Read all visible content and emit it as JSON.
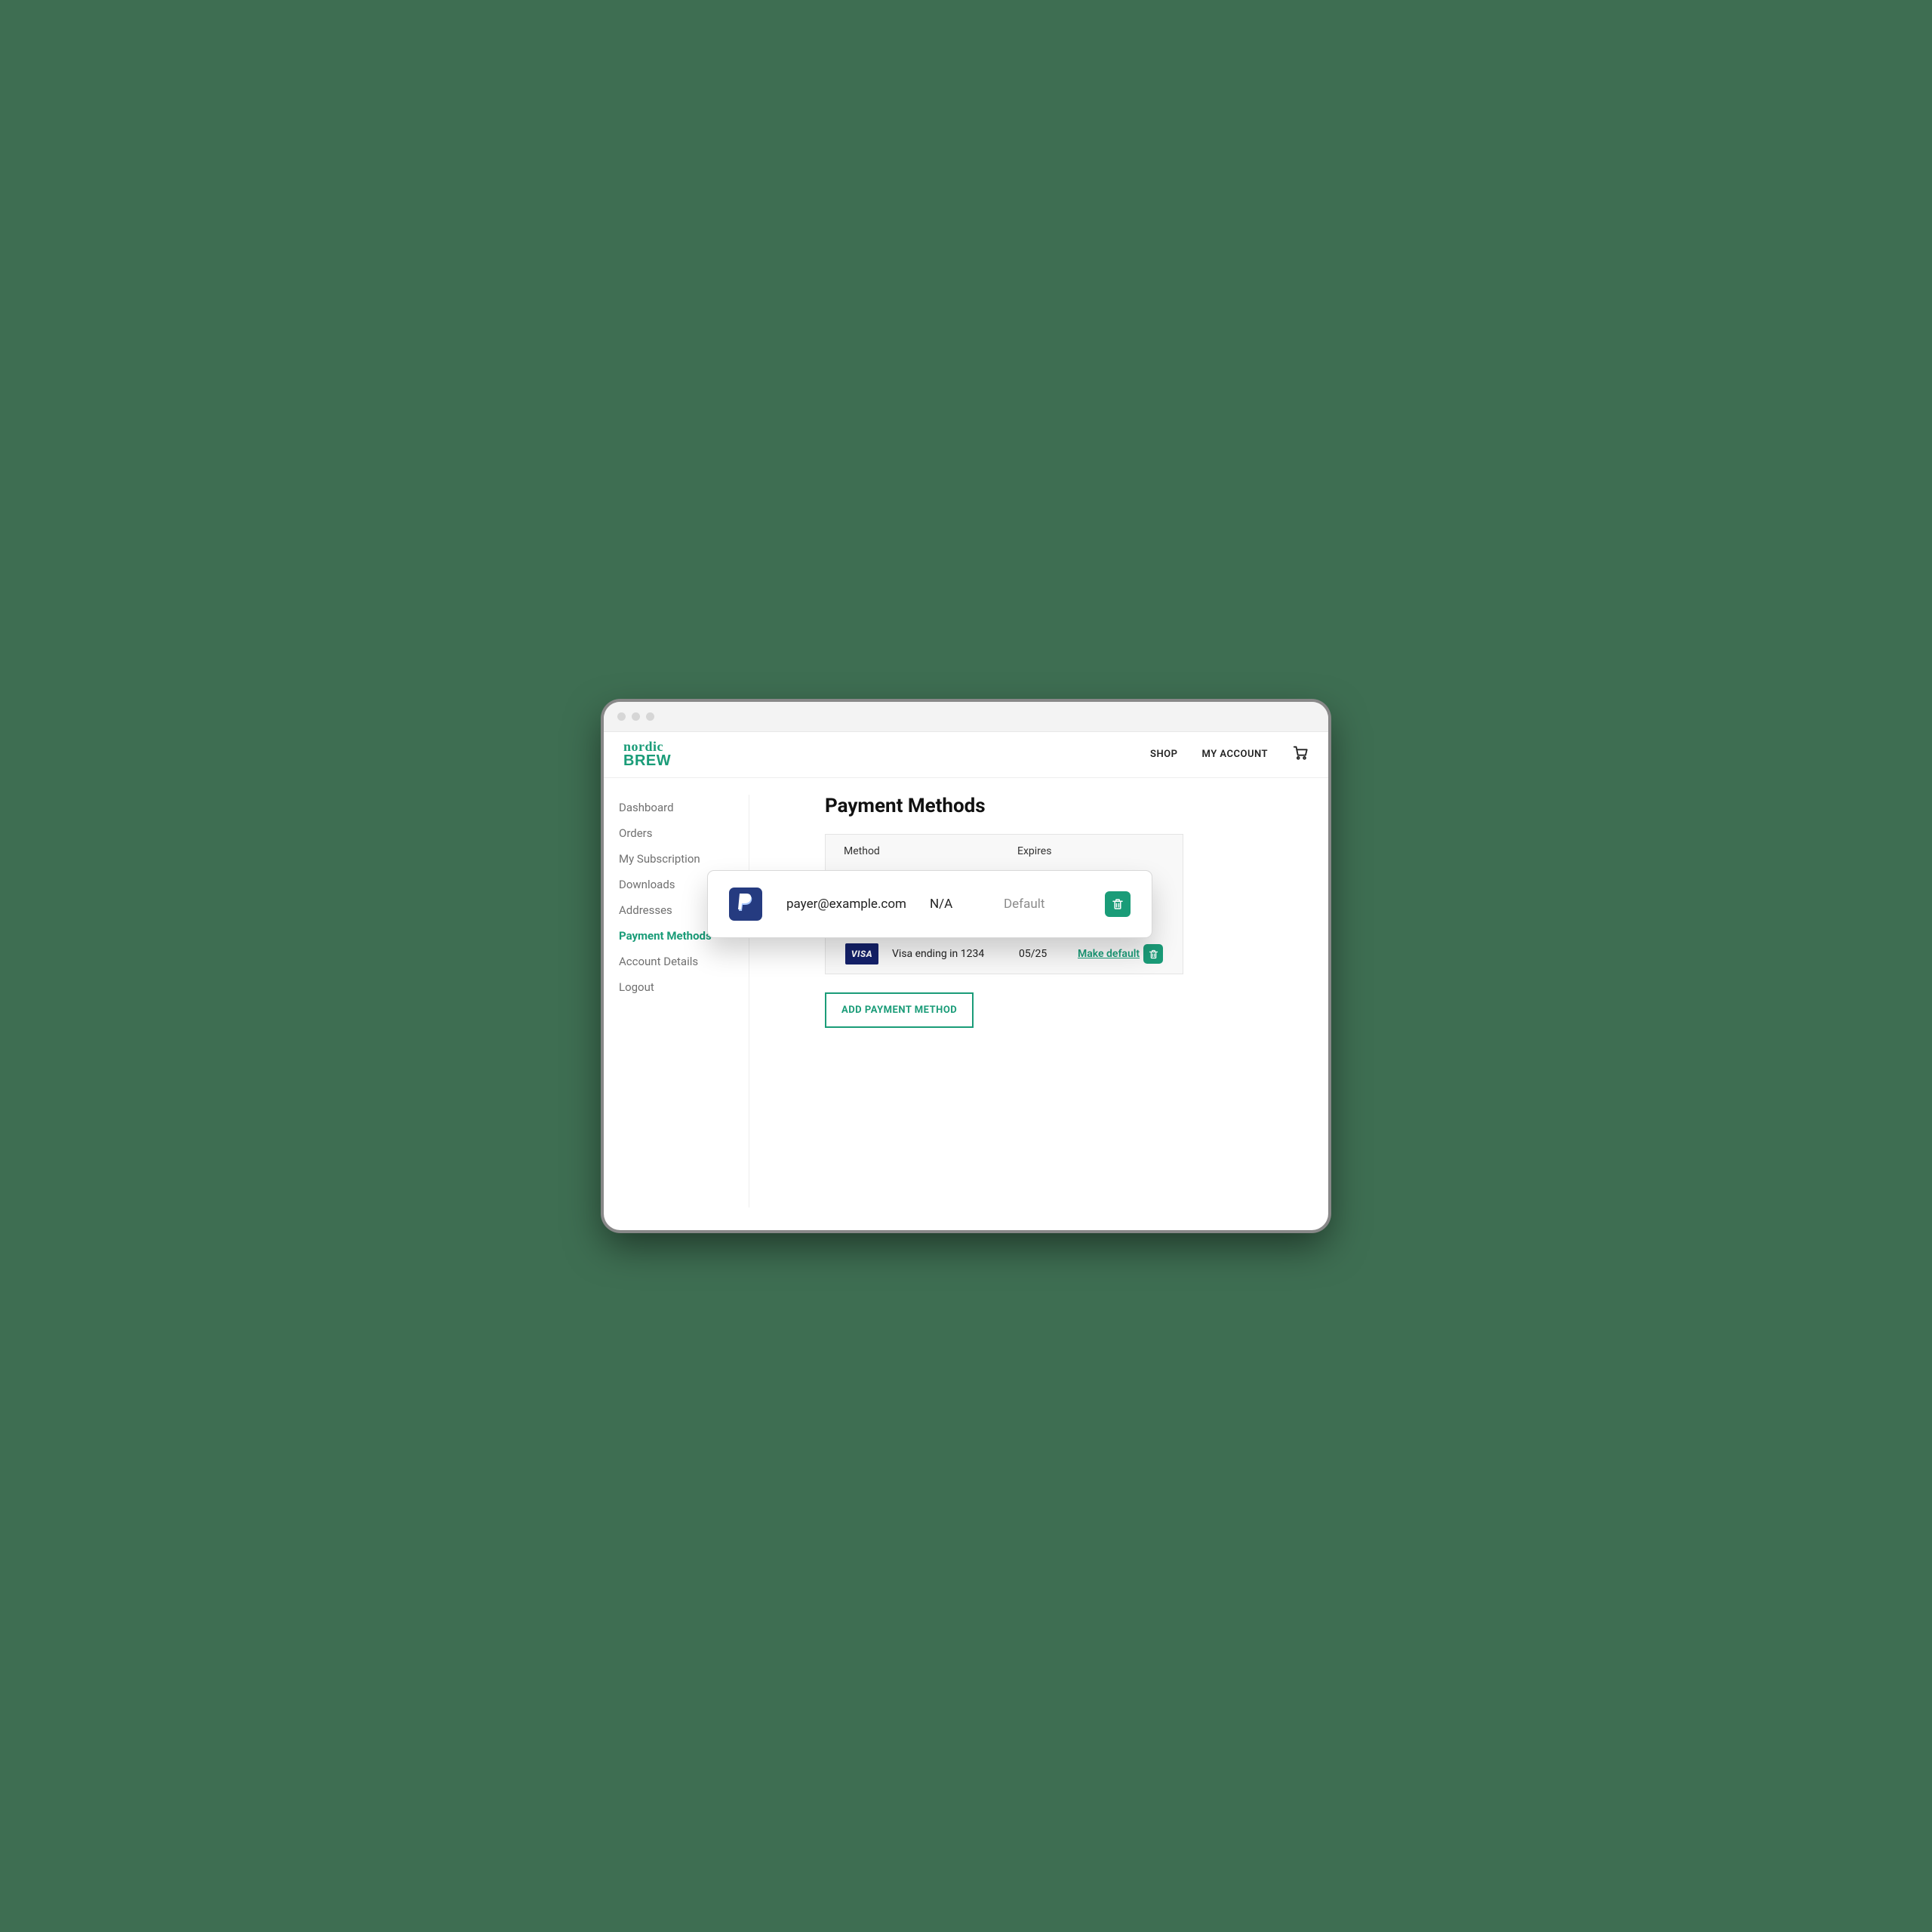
{
  "brand": {
    "top": "nordic",
    "bottom": "BREW"
  },
  "nav": {
    "shop": "SHOP",
    "account": "MY ACCOUNT"
  },
  "sidebar": {
    "items": [
      {
        "label": "Dashboard"
      },
      {
        "label": "Orders"
      },
      {
        "label": "My Subscription"
      },
      {
        "label": "Downloads"
      },
      {
        "label": "Addresses"
      },
      {
        "label": "Payment Methods"
      },
      {
        "label": "Account Details"
      },
      {
        "label": "Logout"
      }
    ],
    "active_index": 5
  },
  "page": {
    "title": "Payment Methods"
  },
  "table": {
    "headers": {
      "method": "Method",
      "expires": "Expires"
    },
    "paypal_row": {
      "brand": "PayPal",
      "email": "payer@example.com",
      "expires": "N/A",
      "status": "Default"
    },
    "visa_row": {
      "brand": "VISA",
      "desc": "Visa ending in 1234",
      "expires": "05/25",
      "action": "Make default"
    }
  },
  "add_button": "ADD PAYMENT METHOD"
}
